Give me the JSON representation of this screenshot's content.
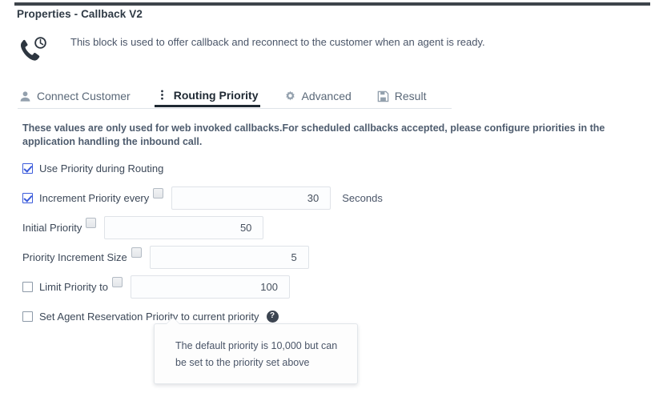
{
  "panel": {
    "title": "Properties - Callback V2",
    "block_icon": "callback-phone-clock-icon",
    "description": "This block is used to offer callback and reconnect to the customer when an agent is ready."
  },
  "tabs": [
    {
      "label": "Connect Customer",
      "icon": "person-icon",
      "active": false
    },
    {
      "label": "Routing Priority",
      "icon": "dots-vertical-icon",
      "active": true
    },
    {
      "label": "Advanced",
      "icon": "gear-icon",
      "active": false
    },
    {
      "label": "Result",
      "icon": "save-disk-icon",
      "active": false
    }
  ],
  "notice": "These values are only used for web invoked callbacks.For scheduled callbacks accepted, please configure priorities in the application handling the inbound call.",
  "form": {
    "use_priority": {
      "label": "Use Priority during Routing",
      "checked": true
    },
    "increment_every": {
      "label": "Increment Priority every",
      "checked": true,
      "value": "30",
      "unit": "Seconds"
    },
    "initial_priority": {
      "label": "Initial Priority",
      "value": "50"
    },
    "increment_size": {
      "label": "Priority Increment Size",
      "value": "5"
    },
    "limit_priority": {
      "label": "Limit Priority to",
      "checked": false,
      "value": "100"
    },
    "agent_reservation": {
      "label": "Set Agent Reservation Priority to current priority",
      "checked": false,
      "help_icon": "question-mark-icon"
    }
  },
  "tooltip": {
    "text": "The default priority is 10,000 but can be set to the priority set above"
  },
  "colors": {
    "top_rule": "#3e444b",
    "checkbox_accent": "#3b5bdb",
    "active_tab_underline": "#1f2933",
    "text": "#3c4858"
  }
}
